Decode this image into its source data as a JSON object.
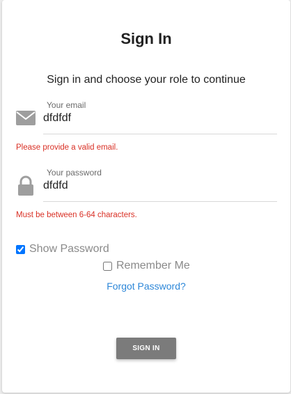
{
  "header": {
    "title": "Sign In",
    "subtitle": "Sign in and choose your role to continue"
  },
  "email": {
    "label": "Your email",
    "value": "dfdfdf",
    "error": "Please provide a valid email.",
    "icon": "envelope-icon"
  },
  "password": {
    "label": "Your password",
    "value": "dfdfd",
    "error": "Must be between 6-64 characters.",
    "icon": "lock-icon"
  },
  "options": {
    "show_password_label": "Show Password",
    "show_password_checked": true,
    "remember_me_label": "Remember Me",
    "remember_me_checked": false,
    "forgot_password_label": "Forgot Password?"
  },
  "actions": {
    "signin_label": "SIGN IN"
  },
  "colors": {
    "error": "#d93025",
    "link": "#2d87d8",
    "button": "#7b7b7b",
    "icon": "#9e9e9e"
  }
}
